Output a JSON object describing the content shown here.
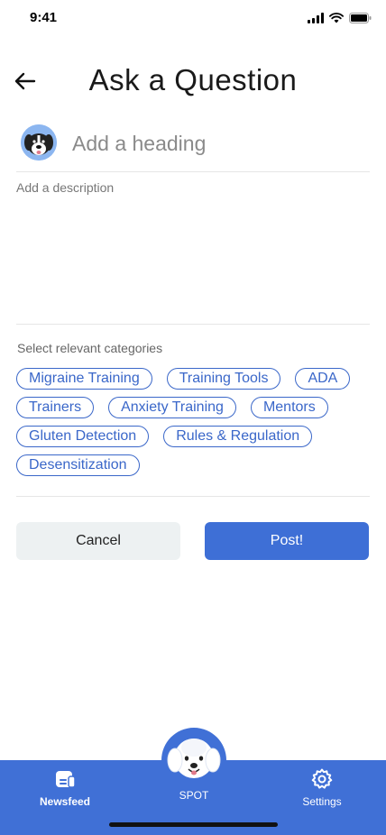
{
  "status": {
    "time": "9:41"
  },
  "header": {
    "title": "Ask a Question"
  },
  "heading": {
    "placeholder": "Add a heading",
    "value": ""
  },
  "description": {
    "placeholder": "Add a description",
    "value": ""
  },
  "categories": {
    "label": "Select relevant categories",
    "rows": [
      [
        "Migraine Training",
        "Training Tools",
        "ADA"
      ],
      [
        "Trainers",
        "Anxiety Training",
        "Mentors"
      ],
      [
        "Gluten Detection",
        "Rules & Regulation"
      ],
      [
        "Desensitization"
      ]
    ]
  },
  "actions": {
    "cancel_label": "Cancel",
    "post_label": "Post!"
  },
  "tabbar": {
    "newsfeed_label": "Newsfeed",
    "spot_label": "SPOT",
    "settings_label": "Settings"
  },
  "colors": {
    "accent": "#3e6fd6",
    "tabbar": "#4070d6",
    "chip": "#3a67c9",
    "cancel_bg": "#edf1f2"
  },
  "icons": [
    "back-arrow-icon",
    "newsfeed-icon",
    "dog-avatar-icon",
    "gear-icon",
    "signal-icon",
    "wifi-icon",
    "battery-icon"
  ]
}
